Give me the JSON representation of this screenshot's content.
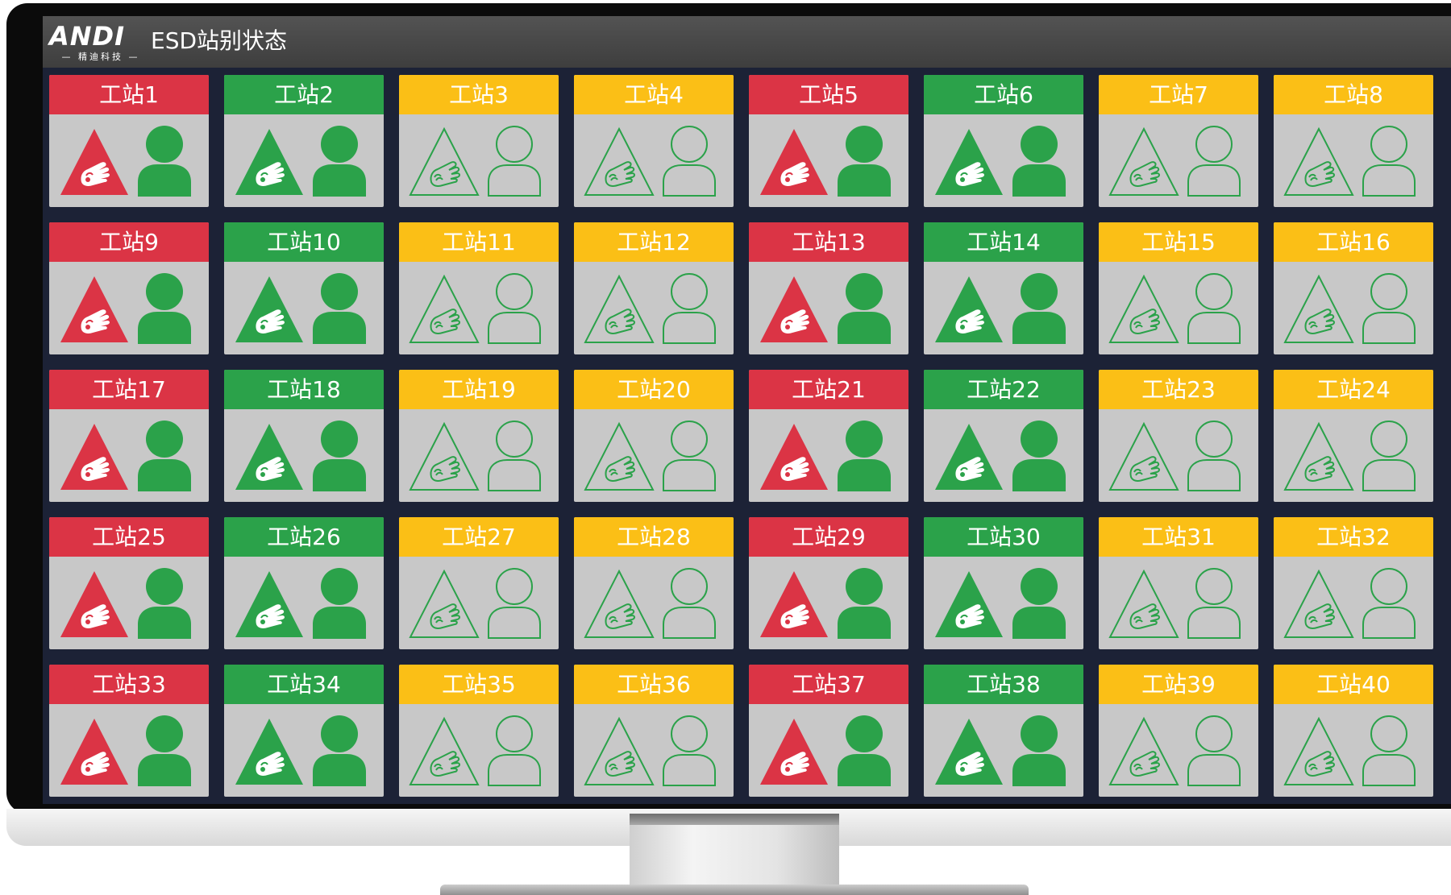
{
  "header": {
    "logo_text": "ANDI",
    "logo_subtext": "— 精迪科技 —",
    "title": "ESD站别状态"
  },
  "colors": {
    "red": "#db3445",
    "green": "#2ba24a",
    "yellow": "#fbbf16",
    "card_body": "#c8c8c8",
    "screen_bg": "#1c2236"
  },
  "icons": {
    "esd": "esd-hand-triangle-icon",
    "operator": "person-icon"
  },
  "stations": [
    {
      "label": "工站1",
      "status": "red"
    },
    {
      "label": "工站2",
      "status": "green"
    },
    {
      "label": "工站3",
      "status": "yellow"
    },
    {
      "label": "工站4",
      "status": "yellow"
    },
    {
      "label": "工站5",
      "status": "red"
    },
    {
      "label": "工站6",
      "status": "green"
    },
    {
      "label": "工站7",
      "status": "yellow"
    },
    {
      "label": "工站8",
      "status": "yellow"
    },
    {
      "label": "工站9",
      "status": "red"
    },
    {
      "label": "工站10",
      "status": "green"
    },
    {
      "label": "工站11",
      "status": "yellow"
    },
    {
      "label": "工站12",
      "status": "yellow"
    },
    {
      "label": "工站13",
      "status": "red"
    },
    {
      "label": "工站14",
      "status": "green"
    },
    {
      "label": "工站15",
      "status": "yellow"
    },
    {
      "label": "工站16",
      "status": "yellow"
    },
    {
      "label": "工站17",
      "status": "red"
    },
    {
      "label": "工站18",
      "status": "green"
    },
    {
      "label": "工站19",
      "status": "yellow"
    },
    {
      "label": "工站20",
      "status": "yellow"
    },
    {
      "label": "工站21",
      "status": "red"
    },
    {
      "label": "工站22",
      "status": "green"
    },
    {
      "label": "工站23",
      "status": "yellow"
    },
    {
      "label": "工站24",
      "status": "yellow"
    },
    {
      "label": "工站25",
      "status": "red"
    },
    {
      "label": "工站26",
      "status": "green"
    },
    {
      "label": "工站27",
      "status": "yellow"
    },
    {
      "label": "工站28",
      "status": "yellow"
    },
    {
      "label": "工站29",
      "status": "red"
    },
    {
      "label": "工站30",
      "status": "green"
    },
    {
      "label": "工站31",
      "status": "yellow"
    },
    {
      "label": "工站32",
      "status": "yellow"
    },
    {
      "label": "工站33",
      "status": "red"
    },
    {
      "label": "工站34",
      "status": "green"
    },
    {
      "label": "工站35",
      "status": "yellow"
    },
    {
      "label": "工站36",
      "status": "yellow"
    },
    {
      "label": "工站37",
      "status": "red"
    },
    {
      "label": "工站38",
      "status": "green"
    },
    {
      "label": "工站39",
      "status": "yellow"
    },
    {
      "label": "工站40",
      "status": "yellow"
    }
  ]
}
